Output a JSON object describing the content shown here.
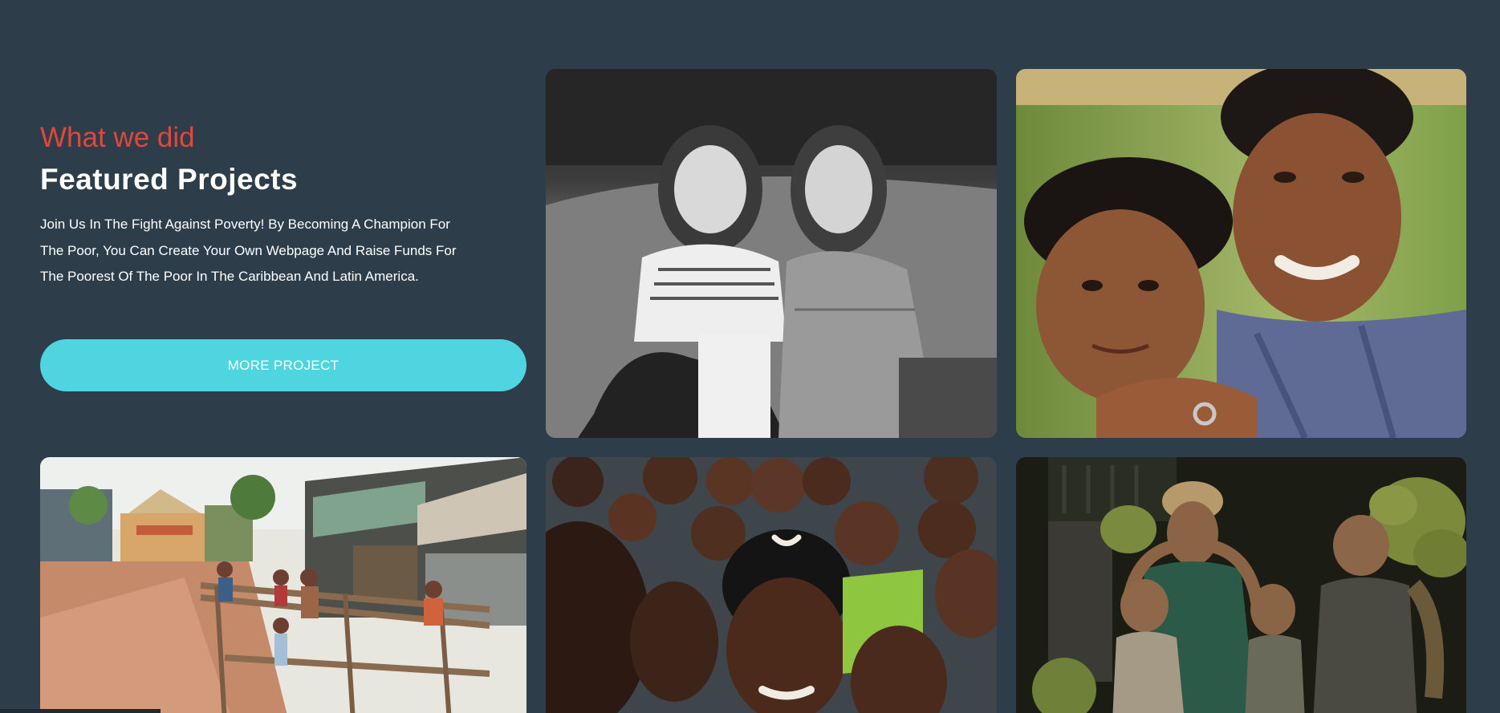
{
  "section": {
    "eyebrow": "What we did",
    "title": "Featured Projects",
    "description": "Join Us In The Fight Against Poverty! By Becoming A Champion For The Poor, You Can Create Your Own Webpage And Raise Funds For The Poorest Of The Poor In The Caribbean And Latin America.",
    "button_label": "MORE PROJECT"
  },
  "colors": {
    "background": "#2d3e4a",
    "accent": "#e2473a",
    "button": "#4fd5e0"
  },
  "gallery": [
    {
      "subject": "two-girls-laughing-photo"
    },
    {
      "subject": "two-smiling-boys-photo"
    },
    {
      "subject": "village-street-children-photo"
    },
    {
      "subject": "group-of-children-photo"
    },
    {
      "subject": "banana-carriers-family-photo"
    }
  ]
}
